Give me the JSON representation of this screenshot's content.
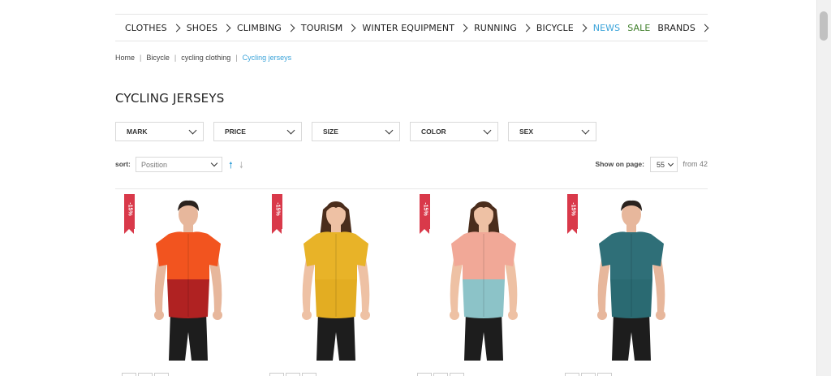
{
  "nav": {
    "items": [
      {
        "label": "CLOTHES",
        "chevron": true,
        "style": "default"
      },
      {
        "label": "SHOES",
        "chevron": true,
        "style": "default"
      },
      {
        "label": "CLIMBING",
        "chevron": true,
        "style": "default"
      },
      {
        "label": "TOURISM",
        "chevron": true,
        "style": "default"
      },
      {
        "label": "WINTER EQUIPMENT",
        "chevron": true,
        "style": "default"
      },
      {
        "label": "RUNNING",
        "chevron": true,
        "style": "default"
      },
      {
        "label": "BICYCLE",
        "chevron": true,
        "style": "default"
      },
      {
        "label": "NEWS",
        "chevron": false,
        "style": "news"
      },
      {
        "label": "SALE",
        "chevron": false,
        "style": "sale"
      },
      {
        "label": "BRANDS",
        "chevron": true,
        "style": "default"
      }
    ]
  },
  "breadcrumb": {
    "items": [
      "Home",
      "Bicycle",
      "cycling clothing"
    ],
    "current": "Cycling jerseys"
  },
  "page": {
    "title": "CYCLING JERSEYS"
  },
  "filters": [
    "MARK",
    "PRICE",
    "SIZE",
    "COLOR",
    "SEX"
  ],
  "sort": {
    "label": "sort:",
    "value": "Position",
    "asc_icon": "arrow-up-icon",
    "desc_icon": "arrow-down-icon"
  },
  "pagination": {
    "show_label": "Show on page:",
    "per_page": "55",
    "total": "from 42"
  },
  "products": [
    {
      "badge": "-15%",
      "shirt_top": "#f2541f",
      "shirt_bottom": "#b02222",
      "pants": "#1d1d1d",
      "skin": "#e7b79c",
      "hair": "#2a221e",
      "gender": "male"
    },
    {
      "badge": "-15%",
      "shirt_top": "#e8b328",
      "shirt_bottom": "#e3ad22",
      "pants": "#1d1d1d",
      "skin": "#eec1a4",
      "hair": "#4a2d1c",
      "gender": "female"
    },
    {
      "badge": "-15%",
      "shirt_top": "#f1a897",
      "shirt_bottom": "#8cc3c8",
      "pants": "#1d1d1d",
      "skin": "#eec1a4",
      "hair": "#4a2d1c",
      "gender": "female"
    },
    {
      "badge": "-15%",
      "shirt_top": "#2f6f78",
      "shirt_bottom": "#2a6a72",
      "pants": "#1d1d1d",
      "skin": "#e7b79c",
      "hair": "#2a221e",
      "gender": "male"
    }
  ],
  "colors": {
    "accent": "#3aa3d9",
    "sale": "#3f7f2a",
    "badge": "#d9394a"
  }
}
